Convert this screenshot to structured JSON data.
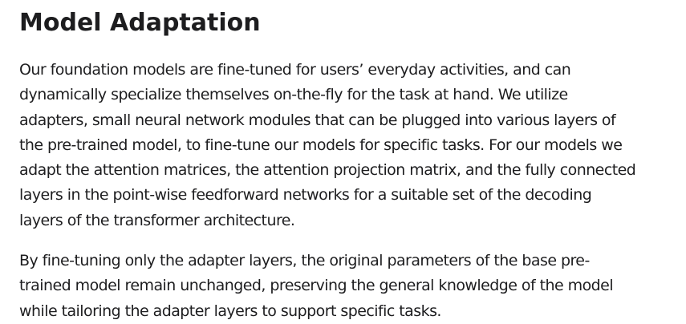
{
  "section": {
    "title": "Model Adaptation",
    "paragraphs": [
      {
        "lines": [
          "Our foundation models are fine-tuned for users’ everyday activities, and can",
          "dynamically specialize themselves on-the-fly for the task at hand. We utilize",
          "adapters, small neural network modules that can be plugged into various layers of",
          "the pre-trained model, to fine-tune our models for specific tasks. For our models we",
          "adapt the attention matrices, the attention projection matrix, and the fully connected",
          "layers in the point-wise feedforward networks for a suitable set of the decoding",
          "layers of the transformer architecture."
        ]
      },
      {
        "lines": [
          "By fine-tuning only the adapter layers, the original parameters of the base pre-",
          "trained model remain unchanged, preserving the general knowledge of the model",
          "while tailoring the adapter layers to support specific tasks."
        ]
      }
    ]
  }
}
